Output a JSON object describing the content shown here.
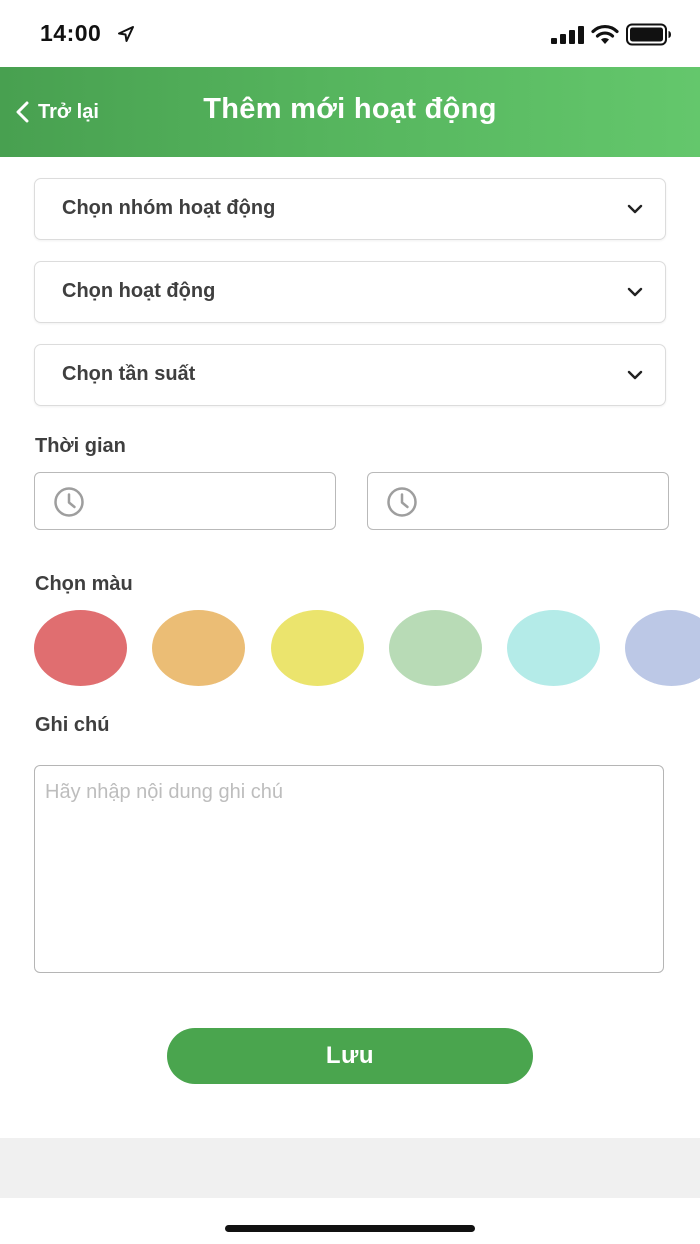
{
  "status_bar": {
    "time": "14:00",
    "icons": [
      "location-arrow-icon",
      "cellular-signal-icon",
      "wifi-icon",
      "battery-icon"
    ]
  },
  "nav": {
    "back_label": "Trở lại",
    "title": "Thêm mới hoạt động",
    "gradient_colors": [
      "#48a050",
      "#64c76c"
    ]
  },
  "form": {
    "activity_group_select": "Chọn nhóm hoạt động",
    "activity_select": "Chọn hoạt động",
    "frequency_select": "Chọn tần suất",
    "time_label": "Thời gian",
    "start_time_value": "",
    "end_time_value": "",
    "color_label": "Chọn màu",
    "colors": [
      "#e06e70",
      "#ebbd75",
      "#ebe46d",
      "#b8dbb6",
      "#b4ebe8",
      "#bcc8e6"
    ],
    "note_label": "Ghi chú",
    "note_placeholder": "Hãy nhập nội dung ghi chú",
    "note_value": ""
  },
  "actions": {
    "save_label": "Lưu",
    "save_color": "#4aa54e"
  }
}
